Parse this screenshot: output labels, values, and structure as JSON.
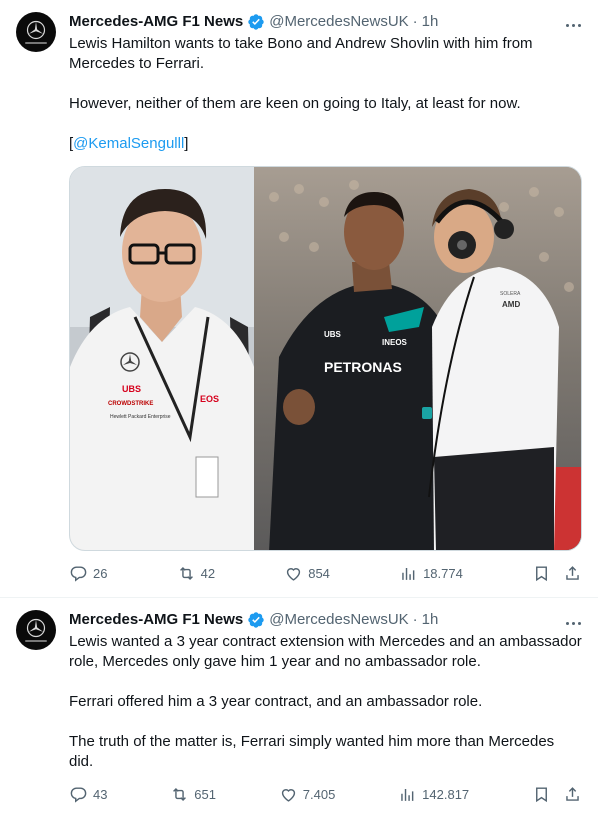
{
  "tweets": [
    {
      "author": "Mercedes-AMG F1 News",
      "handle": "@MercedesNewsUK",
      "separator": "·",
      "time": "1h",
      "paragraphs": [
        "Lewis Hamilton wants to take Bono and Andrew Shovlin with him from Mercedes to Ferrari.",
        "However, neither of them are keen on going to Italy, at least for now."
      ],
      "credit_open": "[",
      "credit_mention": "@KemalSengulll",
      "credit_close": "]",
      "media": {
        "left_photo_shirt_logos": [
          "UBS",
          "CROWDSTRIKE",
          "Hewlett Packard Enterprise"
        ],
        "right_photo_shirt_text": [
          "UBS",
          "INEOS",
          "PETRONAS"
        ],
        "right_photo_engineer_logos": [
          "AMD",
          "SOLERA"
        ]
      },
      "stats": {
        "replies": "26",
        "reposts": "42",
        "likes": "854",
        "views": "18.774"
      }
    },
    {
      "author": "Mercedes-AMG F1 News",
      "handle": "@MercedesNewsUK",
      "separator": "·",
      "time": "1h",
      "paragraphs": [
        "Lewis wanted a 3 year contract extension with Mercedes and an ambassador role, Mercedes only gave him 1 year and no ambassador role.",
        "Ferrari offered him a 3 year contract, and an ambassador role.",
        "The truth of the matter is, Ferrari simply wanted him more than Mercedes did."
      ],
      "stats": {
        "replies": "43",
        "reposts": "651",
        "likes": "7.405",
        "views": "142.817"
      }
    }
  ],
  "icons": {
    "avatar": "mercedes-star-icon",
    "verified": "verified-badge-icon",
    "more": "more-dots-icon",
    "reply": "reply-icon",
    "repost": "repost-icon",
    "like": "heart-icon",
    "views": "views-icon",
    "bookmark": "bookmark-icon",
    "share": "share-icon"
  },
  "colors": {
    "accent": "#1d9bf0",
    "text": "#0f1419",
    "muted": "#536471",
    "border": "#cfd9de"
  }
}
